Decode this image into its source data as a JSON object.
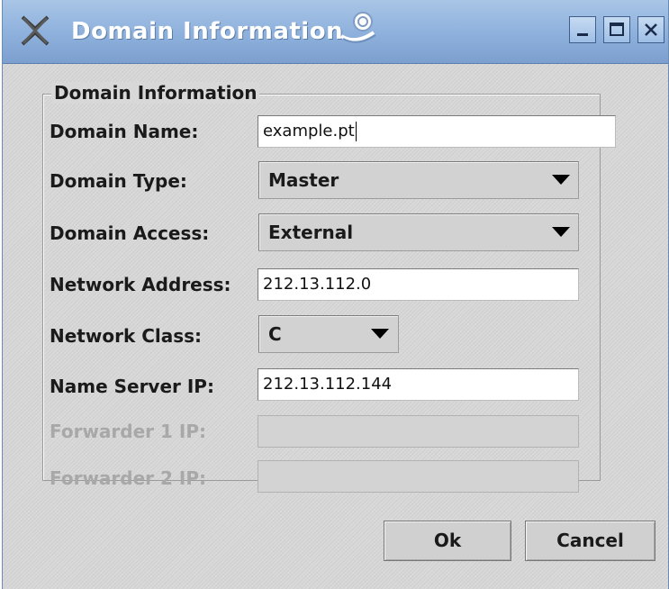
{
  "window": {
    "title": "Domain Information",
    "controls": {
      "minimize": "minimize",
      "maximize": "maximize",
      "close": "close"
    }
  },
  "group": {
    "legend": "Domain Information"
  },
  "fields": {
    "domain_name": {
      "label": "Domain Name:",
      "value": "example.pt"
    },
    "domain_type": {
      "label": "Domain Type:",
      "selected": "Master"
    },
    "domain_access": {
      "label": "Domain Access:",
      "selected": "External"
    },
    "network_address": {
      "label": "Network Address:",
      "value": "212.13.112.0"
    },
    "network_class": {
      "label": "Network Class:",
      "selected": "C"
    },
    "name_server_ip": {
      "label": "Name Server IP:",
      "value": "212.13.112.144"
    },
    "forwarder1_ip": {
      "label": "Forwarder 1 IP:",
      "value": "",
      "disabled": true
    },
    "forwarder2_ip": {
      "label": "Forwarder 2 IP:",
      "value": "",
      "disabled": true
    }
  },
  "buttons": {
    "ok": "Ok",
    "cancel": "Cancel"
  },
  "icons": {
    "window_icon": "x-close-icon",
    "title_decoration": "swirl-logo-icon",
    "dropdown_arrow": "triangle-down-icon"
  },
  "colors": {
    "titlebar": "#8fb2dd",
    "window_bg": "#d8d8d8",
    "disabled_text": "#a8a8a8"
  }
}
